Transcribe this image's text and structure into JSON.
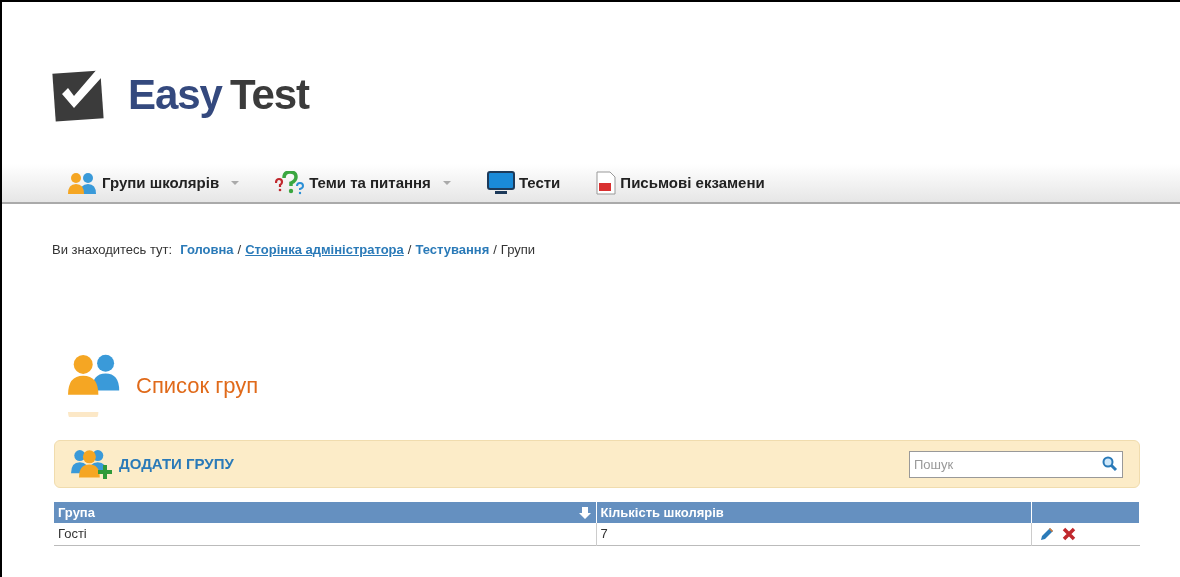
{
  "logo": {
    "word_1": "Easy",
    "word_2": "Test"
  },
  "nav": [
    {
      "label": "Групи школярів",
      "kind": "people",
      "has_menu": true
    },
    {
      "label": "Теми та питання",
      "kind": "questions",
      "has_menu": true
    },
    {
      "label": "Тести",
      "kind": "monitor",
      "has_menu": false
    },
    {
      "label": "Письмові екзамени",
      "kind": "document",
      "has_menu": false
    }
  ],
  "breadcrumb": {
    "prefix": "Ви знаходитесь тут:",
    "items": [
      {
        "label": "Головна",
        "kind": "link",
        "underlined": false
      },
      {
        "separator": "/",
        "label": "Сторінка адміністратора",
        "kind": "link",
        "underlined": true
      },
      {
        "separator": "/",
        "label": "Тестування",
        "kind": "link",
        "underlined": false
      },
      {
        "separator": "/",
        "label": "Групи",
        "kind": "current",
        "underlined": false
      }
    ]
  },
  "page_title": "Список груп",
  "toolbar": {
    "add_button": "ДОДАТИ ГРУПУ",
    "search": {
      "placeholder": "Пошук"
    }
  },
  "table": {
    "columns": [
      {
        "label": "Група",
        "sorted": true
      },
      {
        "label": "Кількість школярів",
        "sorted": false
      },
      {
        "sorted": false
      }
    ],
    "rows": [
      {
        "cells": [
          "Гості",
          "7"
        ]
      }
    ]
  }
}
